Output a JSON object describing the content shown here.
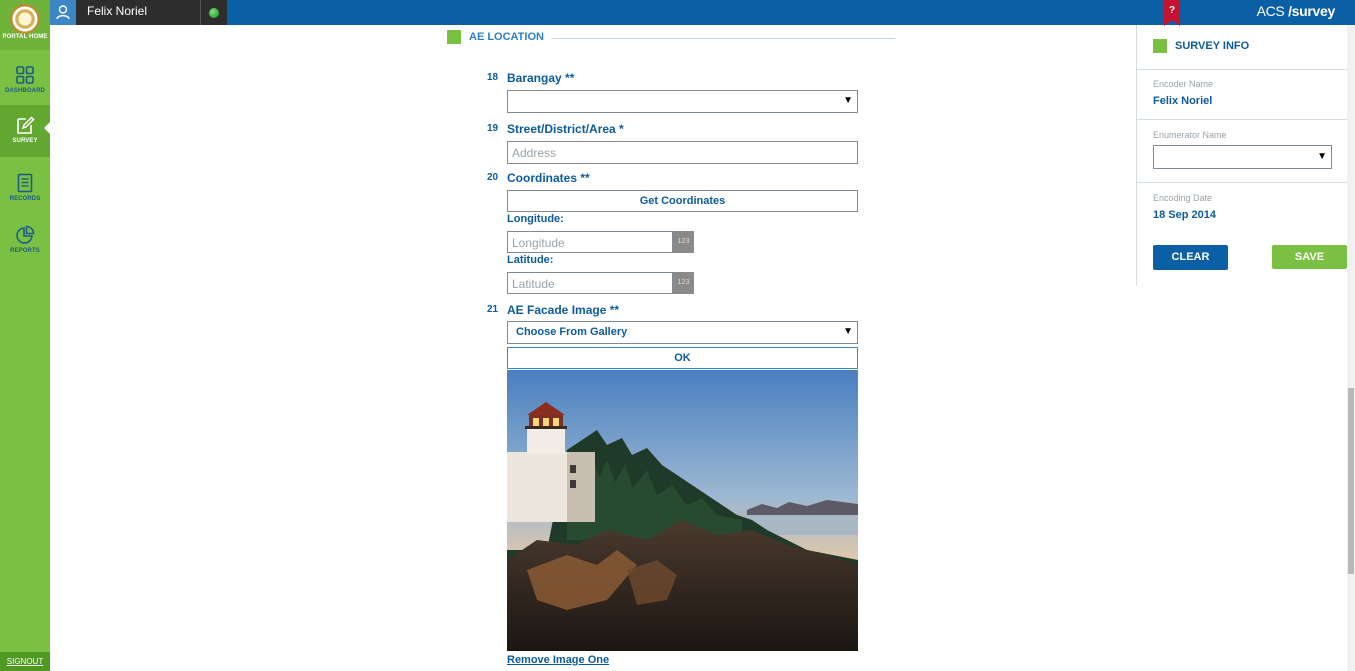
{
  "topbar": {
    "username": "Felix Noriel",
    "brand_prefix": "ACS",
    "brand_suffix": "/survey",
    "help_label": "?"
  },
  "sidebar": {
    "logo_label": "PORTAL HOME",
    "items": [
      {
        "label": "DASHBOARD",
        "icon": "dashboard-grid-icon"
      },
      {
        "label": "SURVEY",
        "icon": "edit-pencil-icon",
        "active": true
      },
      {
        "label": "RECORDS",
        "icon": "document-icon"
      },
      {
        "label": "REPORTS",
        "icon": "pie-chart-icon"
      }
    ],
    "signout": "SIGNOUT"
  },
  "form": {
    "section_title": "AE LOCATION",
    "q18": {
      "number": "18",
      "label": "Barangay **"
    },
    "q19": {
      "number": "19",
      "label": "Street/District/Area *",
      "placeholder": "Address"
    },
    "q20": {
      "number": "20",
      "label": "Coordinates **",
      "button": "Get Coordinates",
      "longitude_label": "Longitude:",
      "longitude_placeholder": "Longitude",
      "latitude_label": "Latitude:",
      "latitude_placeholder": "Latitude",
      "num_badge": "123"
    },
    "q21": {
      "number": "21",
      "label": "AE Facade Image **",
      "select_value": "Choose From Gallery",
      "ok_button": "OK",
      "remove_link": "Remove Image One"
    }
  },
  "survey_info": {
    "title": "SURVEY INFO",
    "encoder_label": "Encoder Name",
    "encoder_value": "Felix Noriel",
    "enumerator_label": "Enumerator Name",
    "encoding_date_label": "Encoding Date",
    "encoding_date_value": "18 Sep 2014",
    "clear_button": "CLEAR",
    "save_button": "SAVE"
  },
  "colors": {
    "topbar": "#0b5fa5",
    "sidebar": "#7ac143",
    "accent_text": "#0d5a9b"
  }
}
